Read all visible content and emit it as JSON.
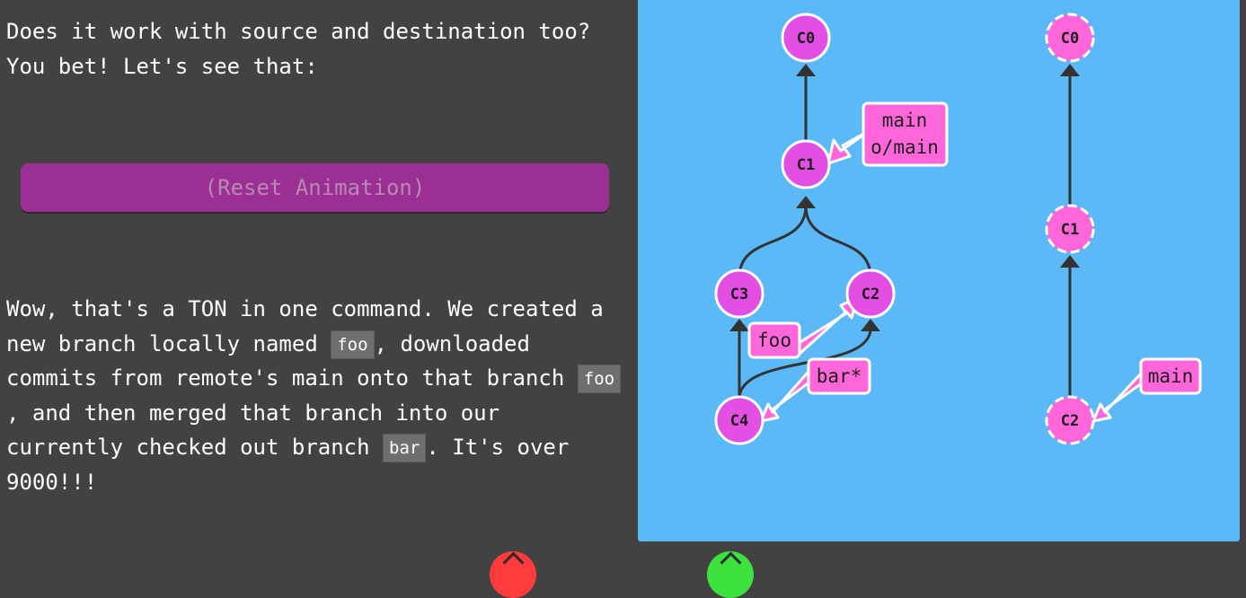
{
  "intro": {
    "line1": "Does it work with source and destination too?",
    "line2": "You bet! Let's see that:"
  },
  "reset_button": {
    "label": "(Reset Animation)"
  },
  "explain": {
    "t1": "Wow, that's a TON in one command. We created a new branch locally named ",
    "code1": "foo",
    "t2": ", downloaded commits from remote's main onto that branch ",
    "code2": "foo",
    "t3": ", and then merged that branch into our currently checked out branch ",
    "code3": "bar",
    "t4": ". It's over 9000!!!"
  },
  "local_repo": {
    "commits": [
      "C0",
      "C1",
      "C2",
      "C3",
      "C4"
    ],
    "branches": {
      "main_line1": "main",
      "main_line2": "o/main",
      "foo": "foo",
      "bar": "bar*"
    }
  },
  "remote_repo": {
    "commits": [
      "C0",
      "C1",
      "C2"
    ],
    "branches": {
      "main": "main"
    }
  },
  "colors": {
    "background": "#424242",
    "viz_background": "#5cb9f8",
    "commit_fill": "#e34fe3",
    "remote_commit_fill": "#ff66d9",
    "branch_fill": "#ff66d9",
    "reset_button": "#9b2f93",
    "edge": "#333333"
  },
  "icons": {
    "prev": "up-arrow-red-icon",
    "next": "up-arrow-green-icon"
  }
}
